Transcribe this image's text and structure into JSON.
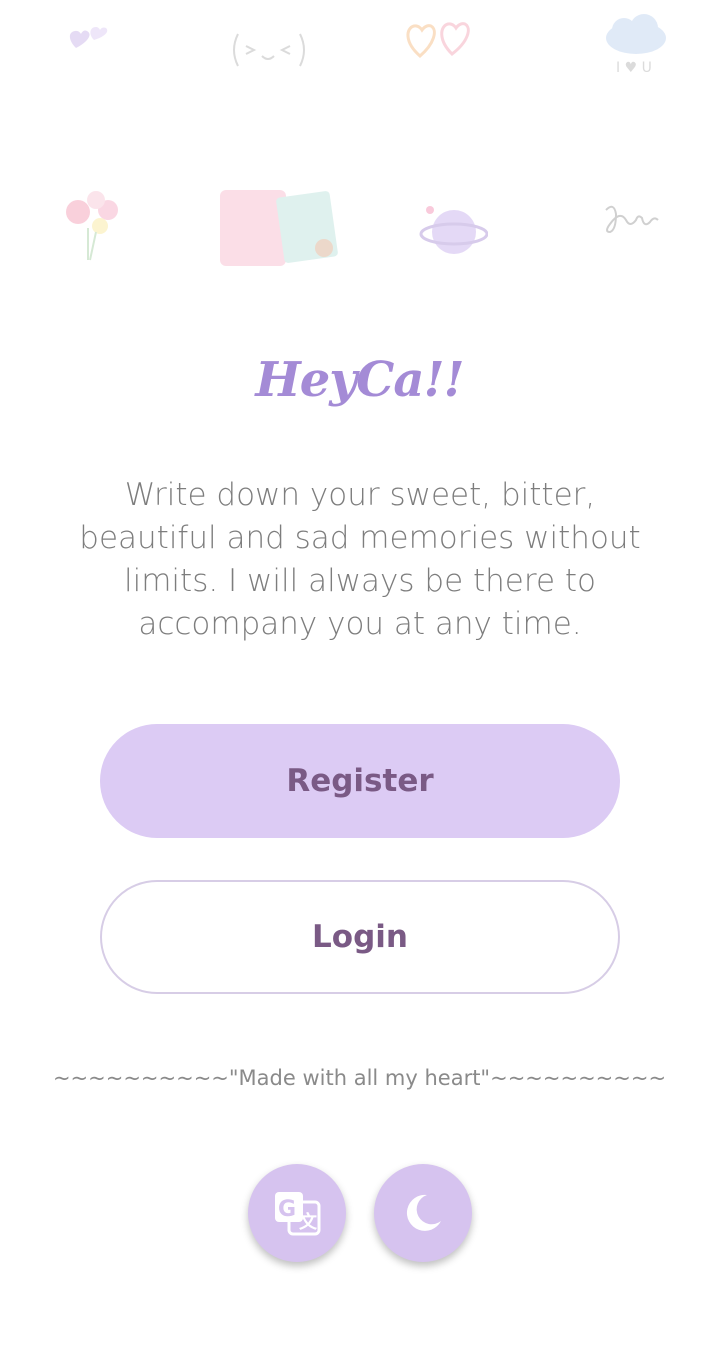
{
  "app": {
    "title": "HeyCa!!"
  },
  "intro": {
    "text": "Write down your sweet, bitter, beautiful and sad memories without limits. I will always be there to accompany you at any time."
  },
  "actions": {
    "register_label": "Register",
    "login_label": "Login"
  },
  "footer": {
    "note": "~~~~~~~~~~\"Made with all my heart\"~~~~~~~~~~"
  },
  "icons": {
    "decorations": [
      "hearts-icon",
      "face-icon",
      "hearts-outline-icon",
      "cloud-love-icon",
      "flowers-icon",
      "notebook-icon",
      "planet-icon",
      "you-script-icon"
    ],
    "translate": "translate-icon",
    "theme": "moon-icon"
  },
  "colors": {
    "accent": "#a48bd6",
    "button_fill": "#dccbf4",
    "button_text": "#7a5a85",
    "round_button": "#d6c3ef"
  }
}
